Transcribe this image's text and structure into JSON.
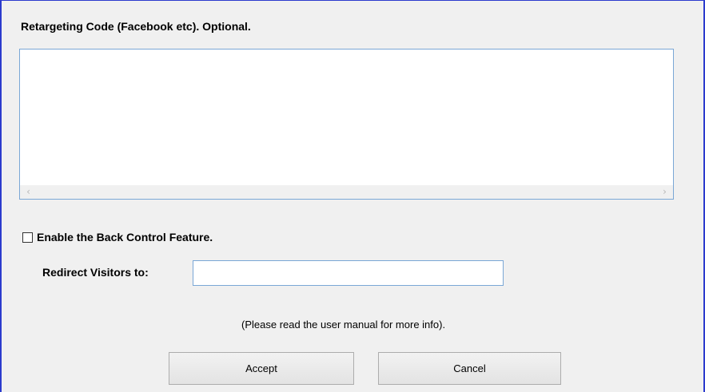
{
  "dialog": {
    "heading": "Retargeting Code (Facebook etc). Optional.",
    "code_box": {
      "value": "",
      "scroll_left_icon": "chevron-left-icon",
      "scroll_right_icon": "chevron-right-icon"
    },
    "back_control": {
      "label": "Enable the Back Control Feature.",
      "checked": false
    },
    "redirect": {
      "label": "Redirect Visitors to:",
      "value": ""
    },
    "info_text": "(Please read the user manual for more info).",
    "buttons": {
      "accept_label": "Accept",
      "cancel_label": "Cancel"
    }
  },
  "colors": {
    "window_border": "#2b3bcd",
    "field_border": "#7aa7d6",
    "background": "#f0f0f0"
  }
}
